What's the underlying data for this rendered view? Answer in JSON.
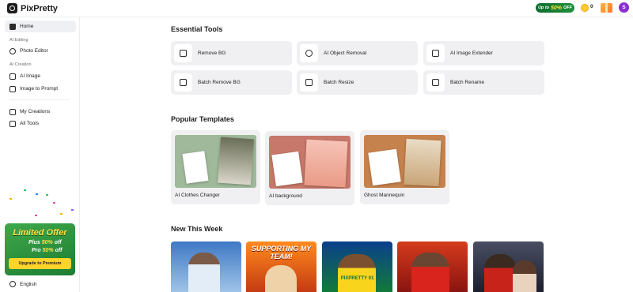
{
  "app": {
    "name": "PixPretty"
  },
  "header": {
    "promo_prefix": "Up to",
    "promo_percent": "50%",
    "promo_suffix": "OFF",
    "coins": "0",
    "avatar_initial": "S"
  },
  "sidebar": {
    "home": "Home",
    "section_editing": "AI Editing",
    "photo_editor": "Photo Editor",
    "section_creation": "AI Creation",
    "ai_image": "AI Image",
    "image_to_prompt": "Image to Prompt",
    "my_creations": "My Creations",
    "all_tools": "All Tools",
    "language": "English"
  },
  "offer": {
    "title": "Limited Offer",
    "plus_prefix": "Plus",
    "plus_percent": "50%",
    "plus_suffix": "off",
    "pro_prefix": "Pro",
    "pro_percent": "50%",
    "pro_suffix": "off",
    "button": "Upgrade to Premium"
  },
  "sections": {
    "essential": "Essential Tools",
    "templates": "Popular Templates",
    "new_week": "New This Week"
  },
  "tools": [
    {
      "label": "Remove BG",
      "icon": "remove-bg-icon"
    },
    {
      "label": "AI Object Removal",
      "icon": "eraser-icon"
    },
    {
      "label": "AI Image Extender",
      "icon": "expand-icon"
    },
    {
      "label": "Batch Remove BG",
      "icon": "batch-remove-icon"
    },
    {
      "label": "Batch Resize",
      "icon": "resize-icon"
    },
    {
      "label": "Batch Rename",
      "icon": "rename-icon"
    }
  ],
  "templates": [
    {
      "label": "AI Clothes Changer"
    },
    {
      "label": "AI background"
    },
    {
      "label": "Ghost Mannequin"
    }
  ],
  "week_items": [
    {
      "caption": ""
    },
    {
      "caption": "SUPPORTING MY TEAM!"
    },
    {
      "caption": "PIXPRETTY 01"
    },
    {
      "caption": ""
    },
    {
      "caption": ""
    }
  ],
  "colors": {
    "accent_green": "#1f8f3c",
    "offer_yellow": "#ffd42a",
    "avatar_purple": "#8a2fd1"
  }
}
